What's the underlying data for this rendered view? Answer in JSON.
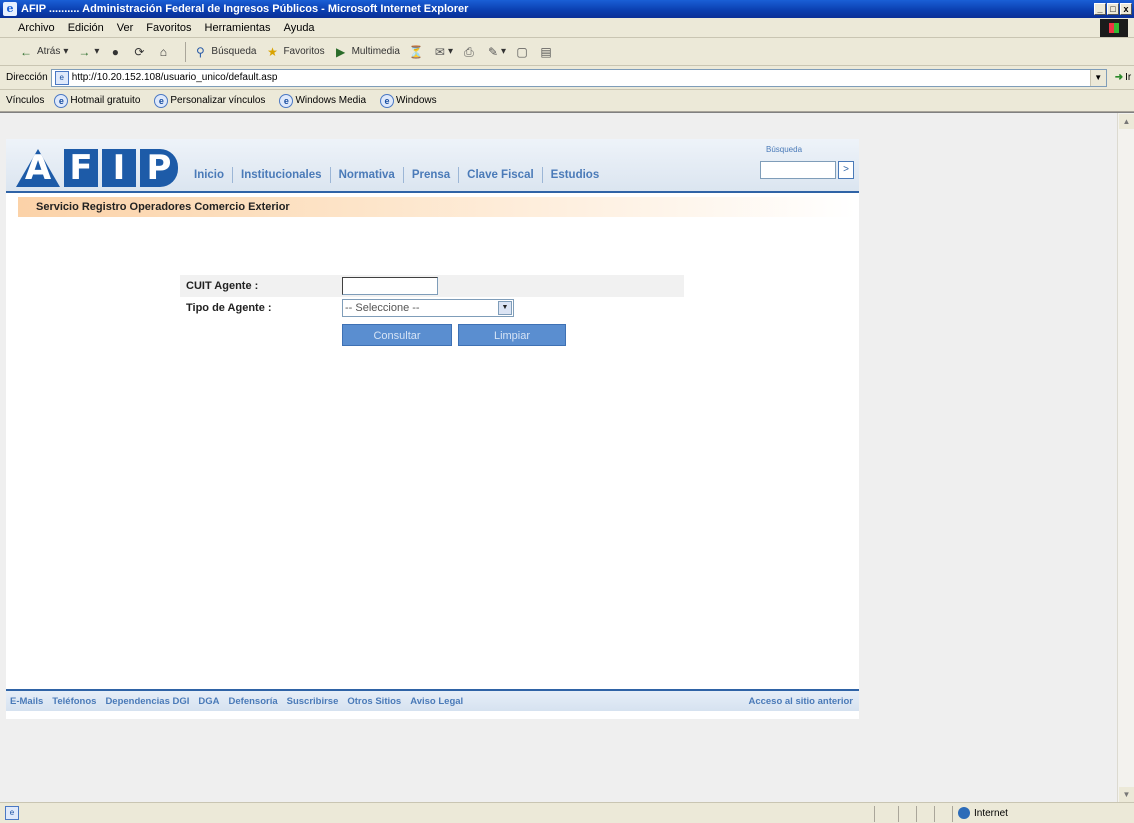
{
  "window": {
    "title": "AFIP .......... Administración Federal de Ingresos Públicos - Microsoft Internet Explorer",
    "min": "_",
    "max": "□",
    "close": "x"
  },
  "menu": {
    "items": [
      {
        "label": "Archivo"
      },
      {
        "label": "Edición"
      },
      {
        "label": "Ver"
      },
      {
        "label": "Favoritos"
      },
      {
        "label": "Herramientas"
      },
      {
        "label": "Ayuda"
      }
    ]
  },
  "toolbar": {
    "back": "Atrás",
    "search": "Búsqueda",
    "favorites": "Favoritos",
    "multimedia": "Multimedia"
  },
  "address": {
    "label": "Dirección",
    "url": "http://10.20.152.108/usuario_unico/default.asp",
    "go": "Ir"
  },
  "links": {
    "label": "Vínculos",
    "items": [
      {
        "label": "Hotmail gratuito"
      },
      {
        "label": "Personalizar vínculos"
      },
      {
        "label": "Windows Media"
      },
      {
        "label": "Windows"
      }
    ]
  },
  "site": {
    "logo": [
      "A",
      "F",
      "I",
      "P"
    ],
    "nav": [
      {
        "label": "Inicio"
      },
      {
        "label": "Institucionales"
      },
      {
        "label": "Normativa"
      },
      {
        "label": "Prensa"
      },
      {
        "label": "Clave Fiscal"
      },
      {
        "label": "Estudios"
      }
    ],
    "search_label": "Búsqueda",
    "search_go": ">"
  },
  "section": {
    "title": "Servicio Registro Operadores Comercio Exterior"
  },
  "form": {
    "cuit_label": "CUIT Agente :",
    "cuit_value": "",
    "tipo_label": "Tipo de Agente :",
    "tipo_selected": "-- Seleccione --",
    "consultar": "Consultar",
    "limpiar": "Limpiar"
  },
  "footer": {
    "links": [
      {
        "label": "E-Mails"
      },
      {
        "label": "Teléfonos"
      },
      {
        "label": "Dependencias DGI"
      },
      {
        "label": "DGA"
      },
      {
        "label": "Defensoría"
      },
      {
        "label": "Suscribirse"
      },
      {
        "label": "Otros Sitios"
      },
      {
        "label": "Aviso Legal"
      }
    ],
    "right": "Acceso al sitio anterior"
  },
  "status": {
    "zone": "Internet"
  }
}
